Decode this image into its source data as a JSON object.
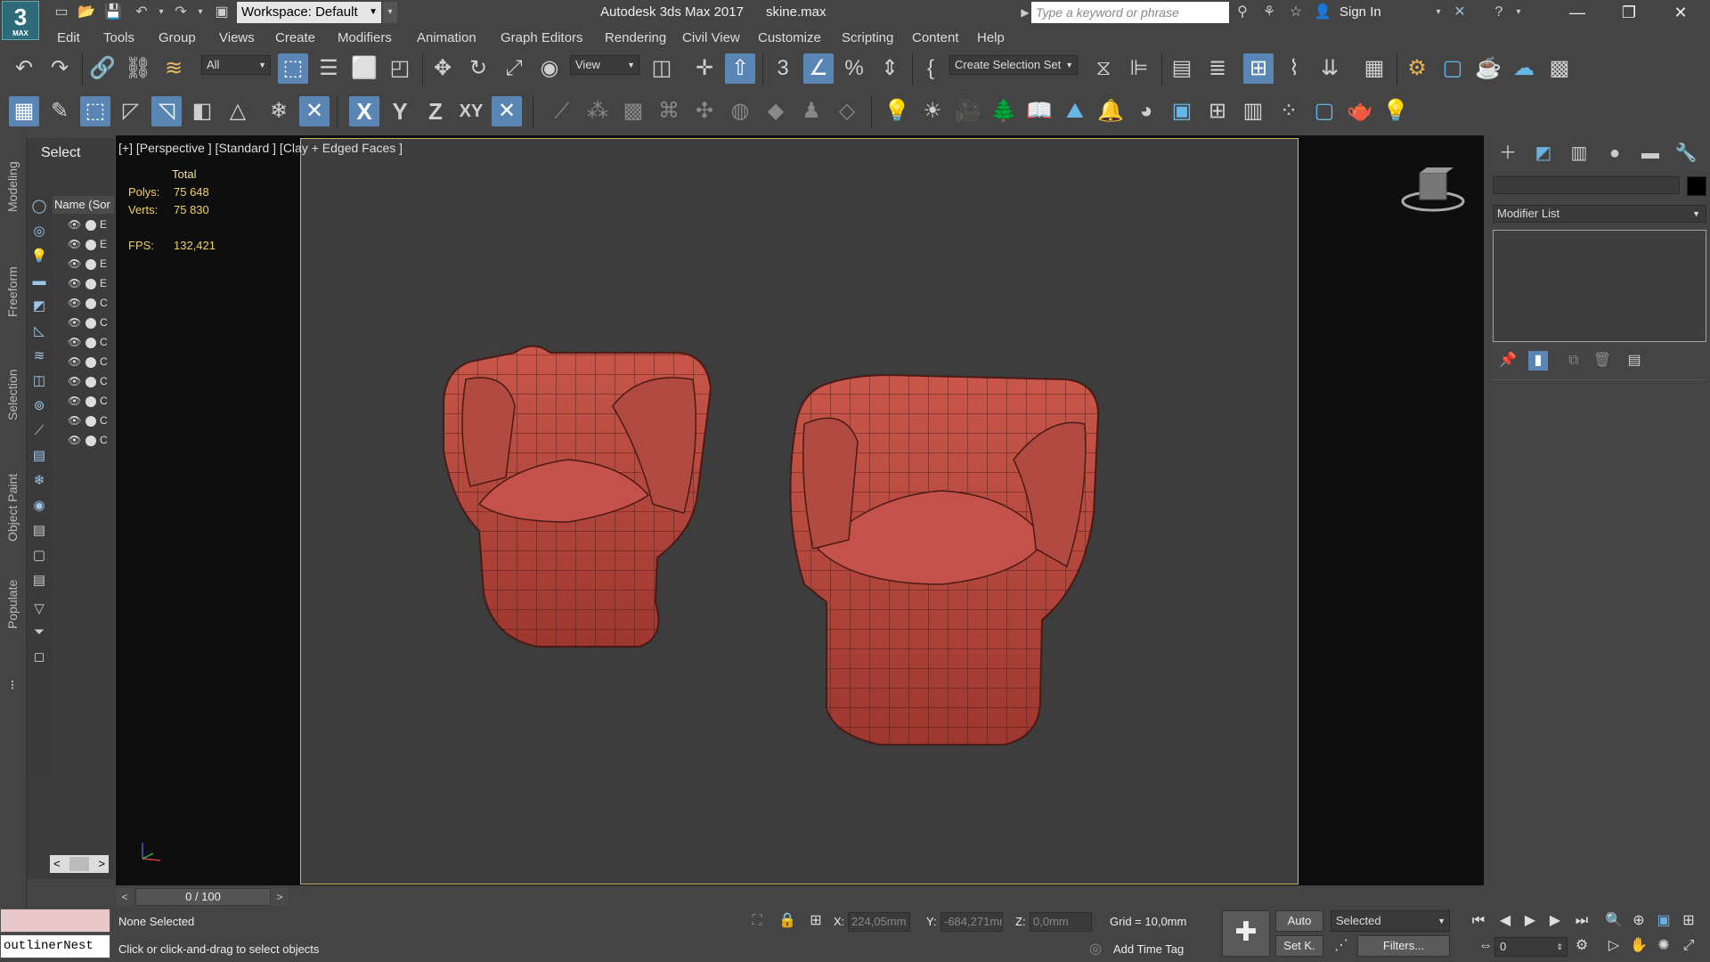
{
  "app": {
    "logo_text": "3",
    "logo_sub": "MAX",
    "title": "Autodesk 3ds Max 2017      skine.max",
    "workspace": "Workspace: Default",
    "search_placeholder": "Type a keyword or phrase",
    "sign_in": "Sign In"
  },
  "menus": [
    "Edit",
    "Tools",
    "Group",
    "Views",
    "Create",
    "Modifiers",
    "Animation",
    "Graph Editors",
    "Rendering",
    "Civil View",
    "Customize",
    "Scripting",
    "Content",
    "Help"
  ],
  "toolbar": {
    "filter_value": "All",
    "refcoord_value": "View",
    "selection_set": "Create Selection Set"
  },
  "ribbon_tabs": [
    "Modeling",
    "Freeform",
    "Selection",
    "Object Paint",
    "Populate"
  ],
  "explorer": {
    "title": "Select",
    "name_column": "Name (Sor",
    "rows": [
      "E",
      "E",
      "E",
      "E",
      "C",
      "C",
      "C",
      "C",
      "C",
      "C",
      "C",
      "C"
    ]
  },
  "viewport": {
    "label": "[+] [Perspective ] [Standard ] [Clay + Edged Faces ]",
    "stats_total_label": "Total",
    "polys_label": "Polys:",
    "polys_value": "75 648",
    "verts_label": "Verts:",
    "verts_value": "75 830",
    "fps_label": "FPS:",
    "fps_value": "132,421"
  },
  "command_panel": {
    "modifier_list": "Modifier List"
  },
  "bottom": {
    "time_slider": "0 / 100",
    "maxscript_text": "outlinerNest",
    "status_selection": "None Selected",
    "status_prompt": "Click or click-and-drag to select objects",
    "x_label": "X:",
    "x_value": "224,05mm",
    "y_label": "Y:",
    "y_value": "-684,271mm",
    "z_label": "Z:",
    "z_value": "0,0mm",
    "grid": "Grid = 10,0mm",
    "add_time_tag": "Add Time Tag",
    "auto": "Auto",
    "set_key": "Set K.",
    "selected": "Selected",
    "filters": "Filters...",
    "frame": "0"
  },
  "colors": {
    "chair": "#b8463c",
    "viewport_bg": "#3d3d3d",
    "active_border": "#c5b766",
    "stats": "#f0d060"
  }
}
